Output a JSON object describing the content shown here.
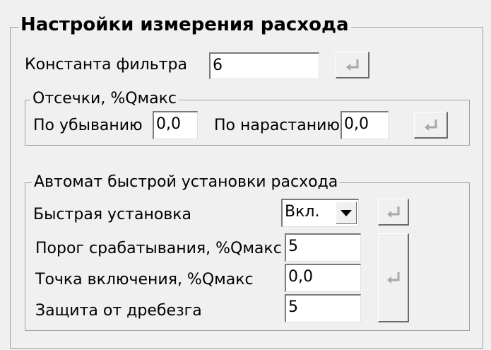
{
  "main_group": {
    "title": "Настройки измерения расхода",
    "filter_label": "Константа фильтра",
    "filter_value": "6"
  },
  "cutoffs": {
    "title": "Отсечки, %Qмакс",
    "decrease_label": "По убыванию",
    "decrease_value": "0,0",
    "increase_label": "По нарастанию",
    "increase_value": "0,0"
  },
  "auto": {
    "title": "Автомат быстрой установки расхода",
    "fast_label": "Быстрая установка",
    "fast_value": "Вкл.",
    "threshold_label": "Порог срабатывания, %Qмакс",
    "threshold_value": "5",
    "point_label": "Точка включения, %Qмакс",
    "point_value": "0,0",
    "debounce_label": "Защита от дребезга",
    "debounce_value": "5"
  },
  "icons": {
    "apply": "enter-icon",
    "dropdown": "chevron-down-icon"
  },
  "colors": {
    "background": "#f0f0f0",
    "border": "#a0a0a0",
    "icon": "#a8a8a8"
  }
}
